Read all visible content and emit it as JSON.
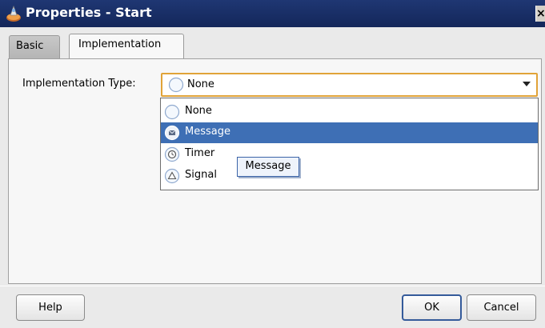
{
  "window": {
    "title": "Properties - Start",
    "close_glyph": "×",
    "title_icon": "properties-icon"
  },
  "tabs": [
    {
      "label": "Basic",
      "selected": false
    },
    {
      "label": "Implementation",
      "selected": true
    }
  ],
  "form": {
    "implementation_type_label": "Implementation Type:",
    "implementation_type_value": "None"
  },
  "dropdown": {
    "options": [
      {
        "label": "None",
        "icon": "none-radio-icon",
        "highlighted": false
      },
      {
        "label": "Message",
        "icon": "message-icon",
        "highlighted": true
      },
      {
        "label": "Timer",
        "icon": "timer-icon",
        "highlighted": false
      },
      {
        "label": "Signal",
        "icon": "signal-icon",
        "highlighted": false
      }
    ]
  },
  "tooltip": {
    "text": "Message"
  },
  "buttons": {
    "help": "Help",
    "ok": "OK",
    "cancel": "Cancel"
  },
  "colors": {
    "titlebar": "#182d64",
    "highlight": "#3e6fb5",
    "focus_border": "#e1a338"
  }
}
